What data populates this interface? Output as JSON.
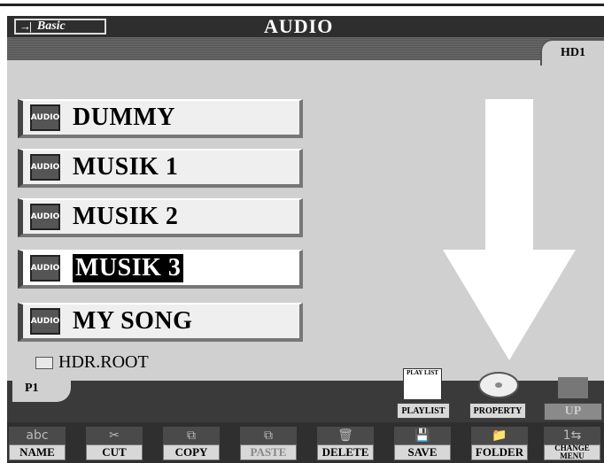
{
  "header": {
    "mode_label": "Basic",
    "mode_icon": "arrow-right-bar-icon",
    "title": "AUDIO"
  },
  "drive_tab": "HD1",
  "files": [
    {
      "name": "DUMMY",
      "icon_label": "AUDIO",
      "selected": false
    },
    {
      "name": "MUSIK 1",
      "icon_label": "AUDIO",
      "selected": false
    },
    {
      "name": "MUSIK 2",
      "icon_label": "AUDIO",
      "selected": false
    },
    {
      "name": "MUSIK 3",
      "icon_label": "AUDIO",
      "selected": true
    },
    {
      "name": "MY SONG",
      "icon_label": "AUDIO",
      "selected": false
    }
  ],
  "folder": "HDR.ROOT",
  "page_tab": "P1",
  "actions": {
    "playlist_icon_label": "PLAY LIST",
    "playlist": "PLAYLIST",
    "property": "PROPERTY",
    "up": "UP"
  },
  "functions": [
    {
      "label": "NAME",
      "icon": "abc-underline-icon",
      "icon_text": "abc"
    },
    {
      "label": "CUT",
      "icon": "scissors-icon",
      "icon_text": "✂"
    },
    {
      "label": "COPY",
      "icon": "copy-icon",
      "icon_text": "⧉"
    },
    {
      "label": "PASTE",
      "icon": "paste-icon",
      "icon_text": "⧉",
      "disabled": true
    },
    {
      "label": "DELETE",
      "icon": "trash-icon",
      "icon_text": "🗑"
    },
    {
      "label": "SAVE",
      "icon": "floppy-icon",
      "icon_text": "💾"
    },
    {
      "label": "FOLDER",
      "icon": "new-folder-icon",
      "icon_text": "📁"
    },
    {
      "label": "CHANGE MENU",
      "icon": "change-menu-icon",
      "icon_text": "1⇆"
    }
  ]
}
